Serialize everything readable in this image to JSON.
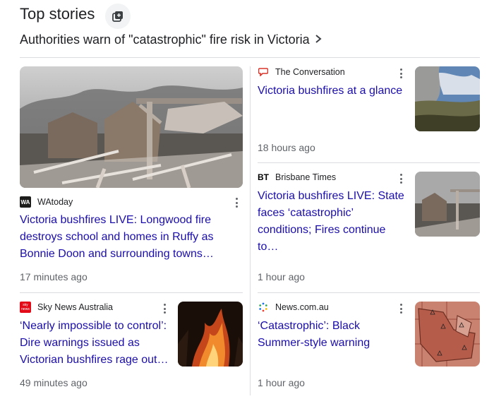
{
  "header": {
    "title": "Top stories",
    "icon": "stack-icon"
  },
  "topic": {
    "label": "Authorities warn of \"catastrophic\" fire risk in Victoria",
    "icon": "chevron-right-icon"
  },
  "stories": [
    {
      "source": "WAtoday",
      "favicon_text": "WA",
      "headline": "Victoria bushfires LIVE: Longwood fire destroys school and homes in Ruffy as Bonnie Doon and surrounding towns…",
      "time": "17 minutes ago"
    },
    {
      "source": "The Conversation",
      "headline": "Victoria bushfires at a glance",
      "time": "18 hours ago"
    },
    {
      "source": "Brisbane Times",
      "favicon_text": "BT",
      "headline": "Victoria bushfires LIVE: State faces ‘catastrophic’ conditions; Fires continue to…",
      "time": "1 hour ago"
    },
    {
      "source": "Sky News Australia",
      "favicon_text": "sky news",
      "headline": "‘Nearly impossible to control’: Dire warnings issued as Victorian bushfires rage out…",
      "time": "49 minutes ago"
    },
    {
      "source": "News.com.au",
      "headline": "‘Catastrophic’: Black Summer-style warning",
      "time": "1 hour ago"
    }
  ],
  "colors": {
    "link": "#1a0dab",
    "meta": "#5f6368",
    "divider": "#dadce0",
    "conversation_red": "#d8352a",
    "sky_red": "#e30b17"
  }
}
